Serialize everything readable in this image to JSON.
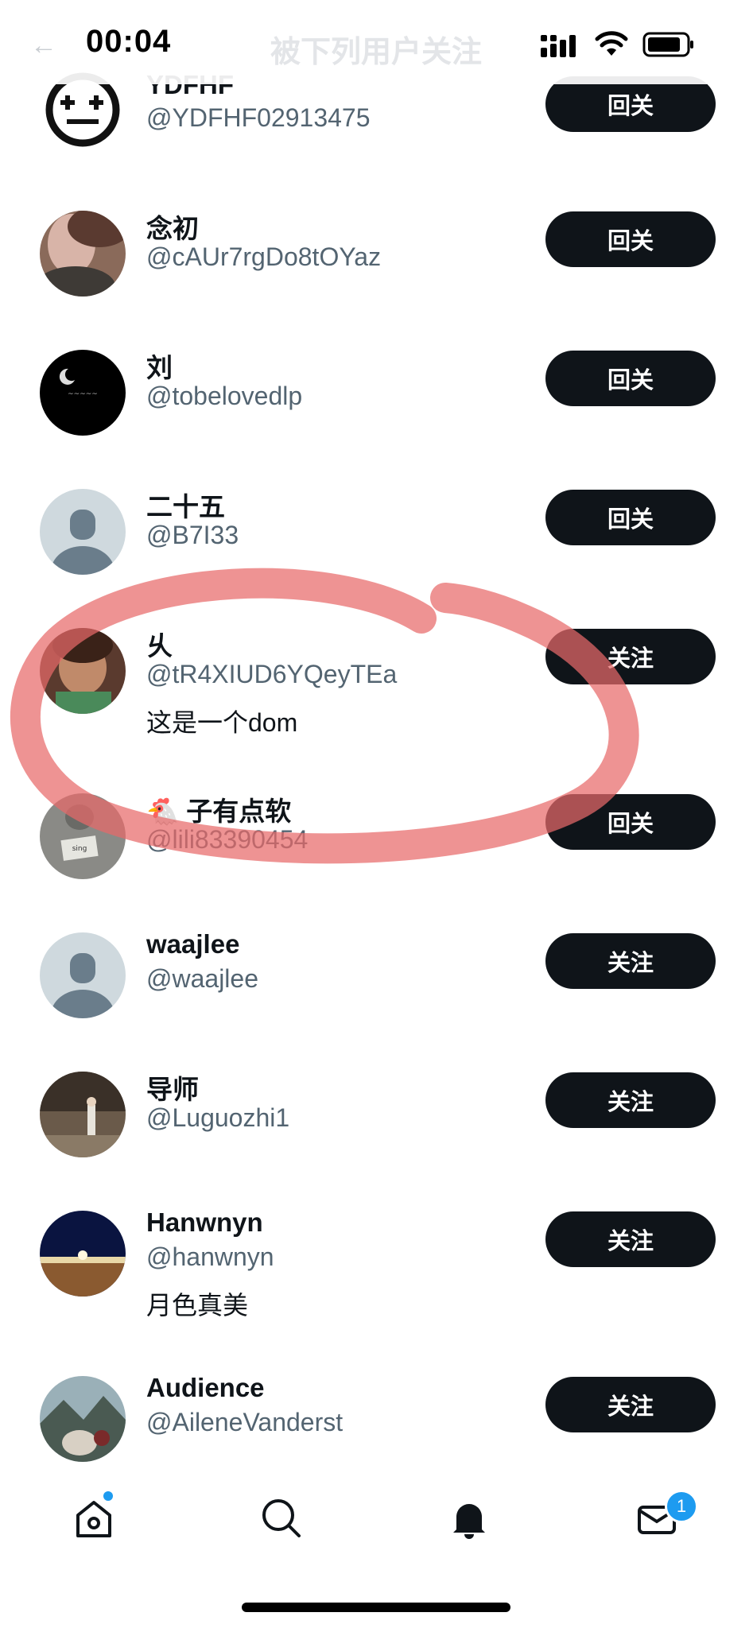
{
  "status_bar": {
    "time": "00:04"
  },
  "header": {
    "title": "被下列用户关注"
  },
  "users": [
    {
      "name": "YDFHF",
      "handle": "@YDFHF02913475",
      "bio": "",
      "button": "回关",
      "avatar": "robot-face"
    },
    {
      "name": "念初",
      "handle": "@cAUr7rgDo8tOYaz",
      "bio": "",
      "button": "回关",
      "avatar": "photo-portrait"
    },
    {
      "name": "刘",
      "handle": "@tobelovedlp",
      "bio": "",
      "button": "回关",
      "avatar": "moon-night"
    },
    {
      "name": "二十五",
      "handle": "@B7I33",
      "bio": "",
      "button": "回关",
      "avatar": "default-person"
    },
    {
      "name": "乆",
      "handle": "@tR4XIUD6YQeyTEa",
      "bio": "这是一个dom",
      "button": "关注",
      "avatar": "cartoon-girl"
    },
    {
      "name": "🐔 子有点软",
      "handle": "@lili83390454",
      "bio": "",
      "button": "回关",
      "avatar": "sing-at-night"
    },
    {
      "name": "waajlee",
      "handle": "@waajlee",
      "bio": "",
      "button": "关注",
      "avatar": "default-person"
    },
    {
      "name": "导师",
      "handle": "@Luguozhi1",
      "bio": "",
      "button": "关注",
      "avatar": "street-photo"
    },
    {
      "name": "Hanwnyn",
      "handle": "@hanwnyn",
      "bio": "月色真美",
      "button": "关注",
      "avatar": "bridge-lights"
    },
    {
      "name": "Audience",
      "handle": "@AileneVanderst",
      "bio": "",
      "button": "关注",
      "avatar": "mountain-dog"
    }
  ],
  "bottom_nav": {
    "items": [
      "home-icon",
      "search-icon",
      "bell-icon",
      "mail-icon"
    ],
    "mail_badge": "1"
  },
  "colors": {
    "button_bg": "#0f1419",
    "handle": "#536471",
    "accent": "#1d9bf0",
    "annotation": "#e86a6a"
  }
}
